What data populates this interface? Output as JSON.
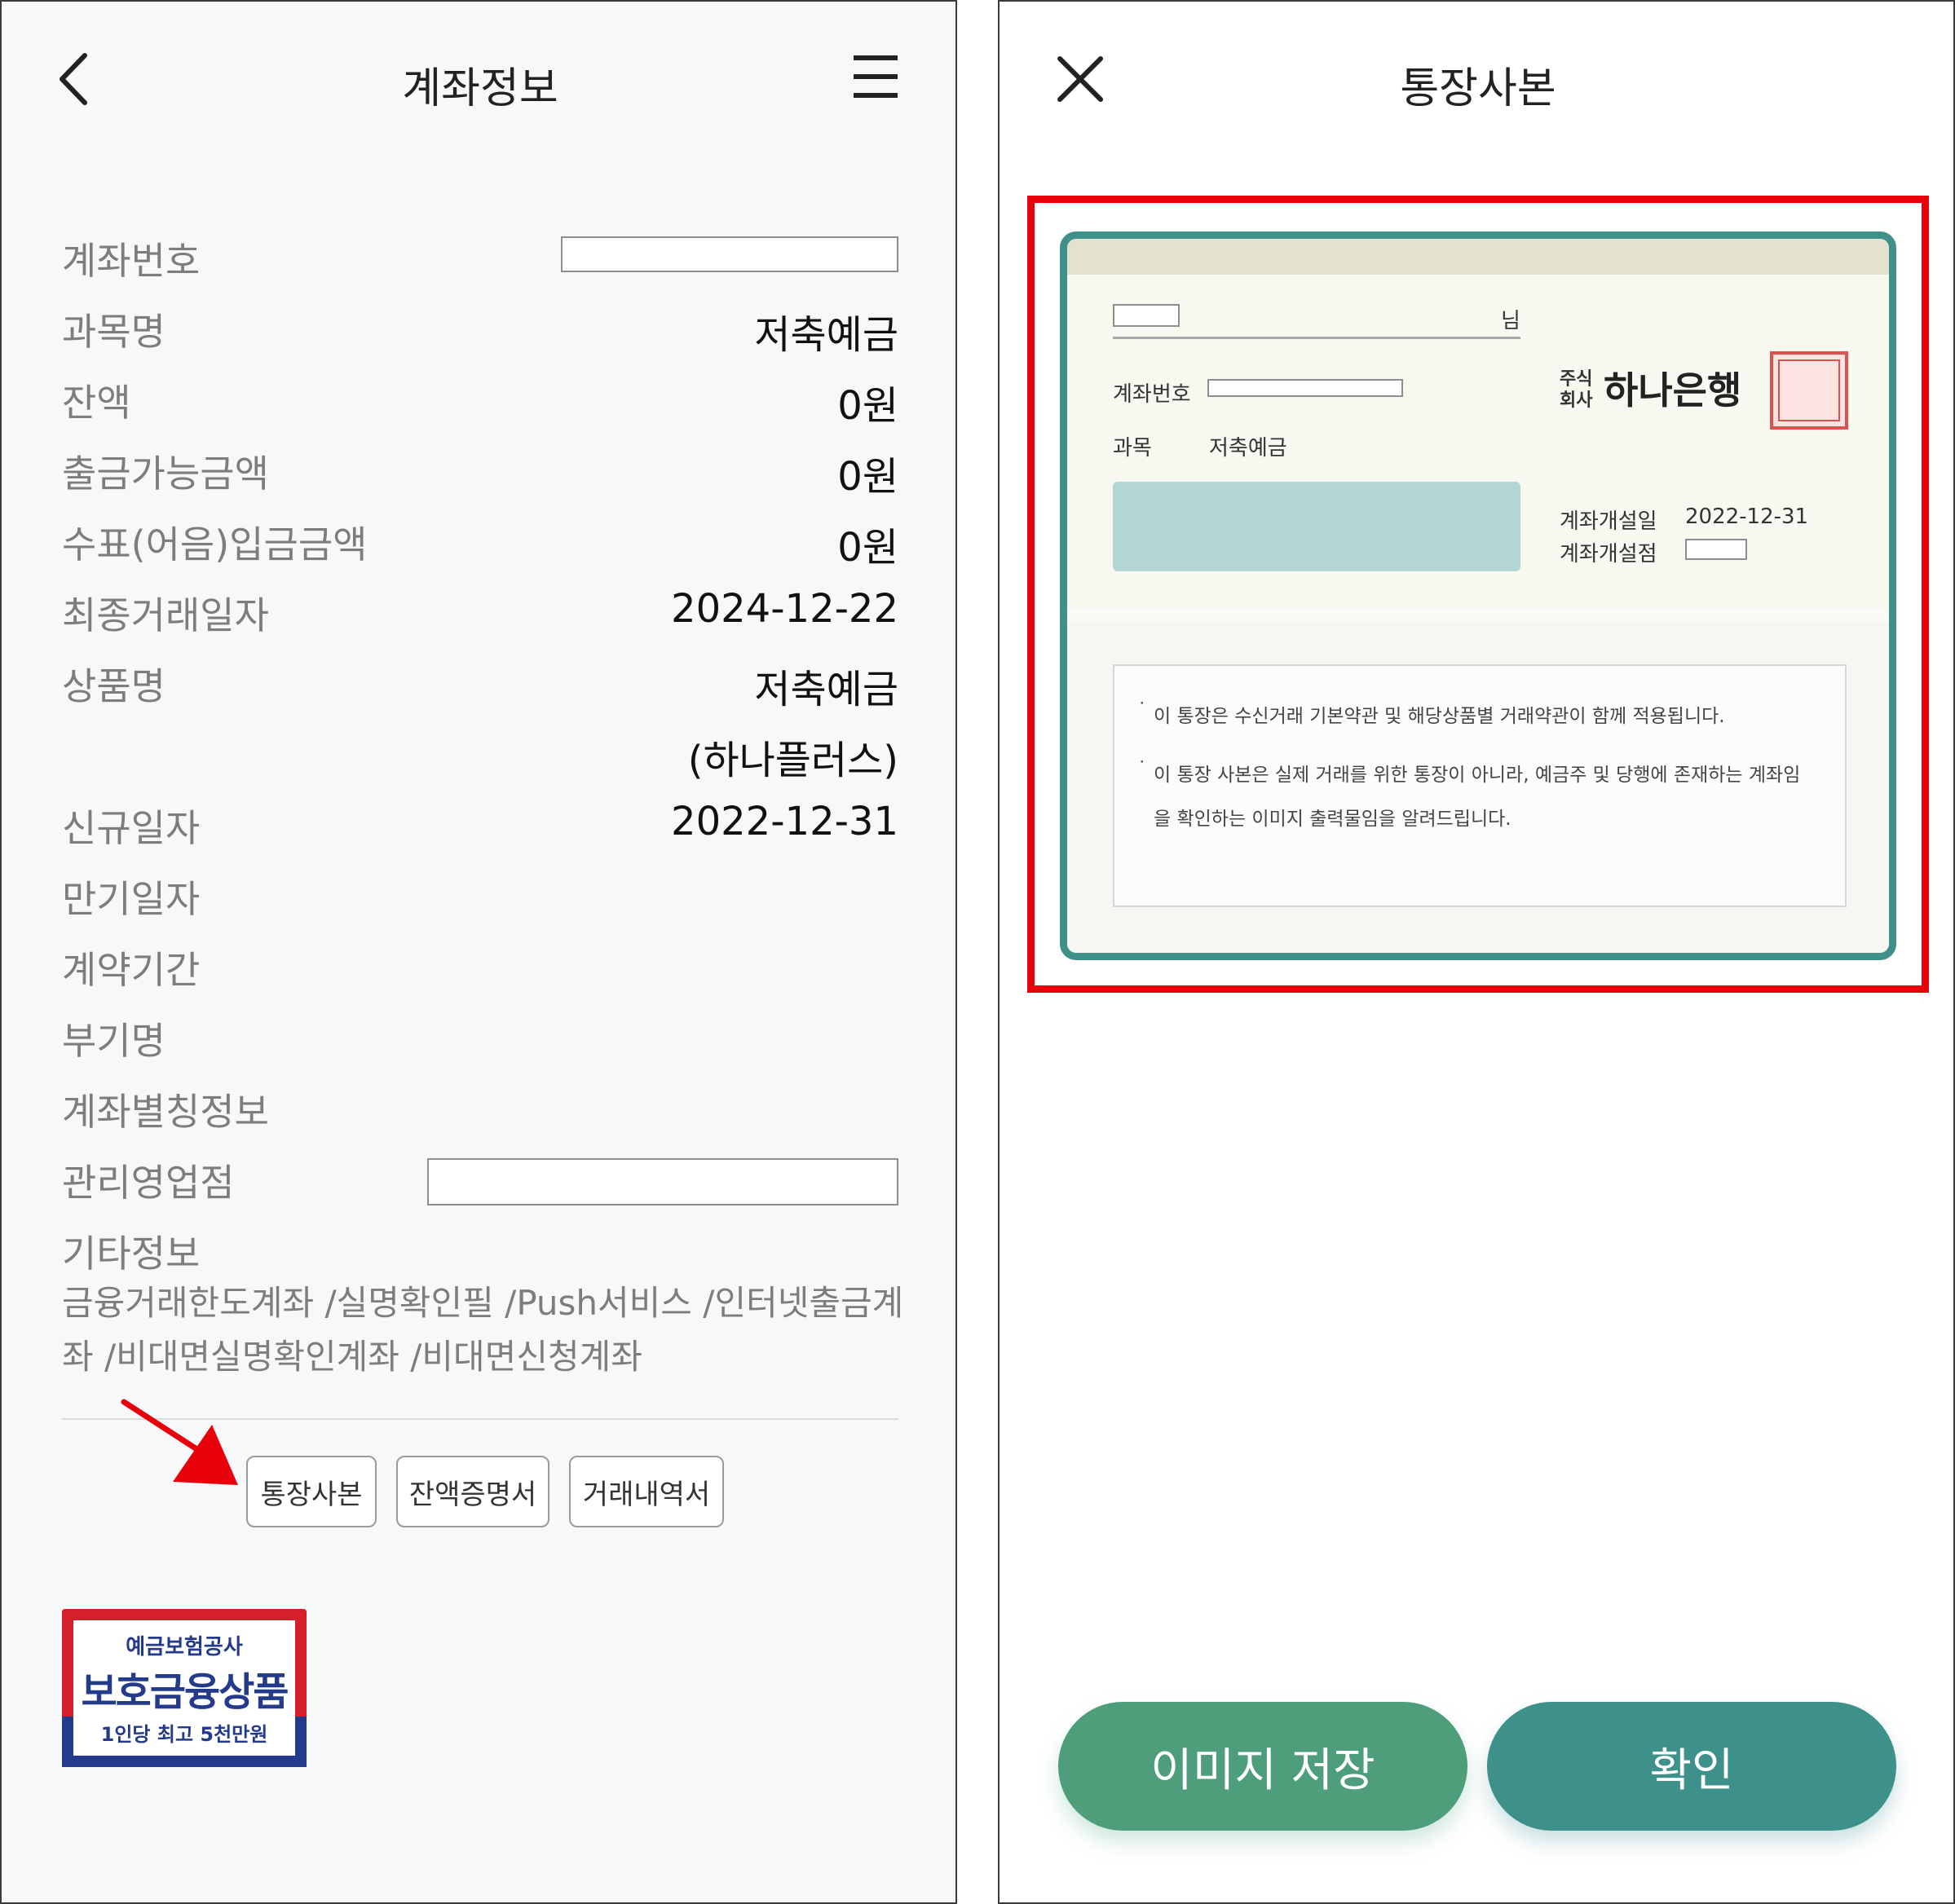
{
  "left": {
    "title": "계좌정보",
    "rows": [
      {
        "label": "계좌번호",
        "value": ""
      },
      {
        "label": "과목명",
        "value": "저축예금"
      },
      {
        "label": "잔액",
        "value": "0원"
      },
      {
        "label": "출금가능금액",
        "value": "0원"
      },
      {
        "label": "수표(어음)입금금액",
        "value": "0원"
      },
      {
        "label": "최종거래일자",
        "value": "2024-12-22"
      },
      {
        "label": "상품명",
        "value": "저축예금"
      },
      {
        "label": "",
        "value": "(하나플러스)"
      },
      {
        "label": "신규일자",
        "value": "2022-12-31"
      },
      {
        "label": "만기일자",
        "value": ""
      },
      {
        "label": "계약기간",
        "value": ""
      },
      {
        "label": "부기명",
        "value": ""
      },
      {
        "label": "계좌별칭정보",
        "value": ""
      },
      {
        "label": "관리영업점",
        "value": ""
      },
      {
        "label": "기타정보",
        "value": ""
      }
    ],
    "etc_text": "금융거래한도계좌 /실명확인필 /Push서비스 /인터넷출금계좌 /비대면실명확인계좌 /비대면신청계좌",
    "buttons": {
      "passbook": "통장사본",
      "balance": "잔액증명서",
      "history": "거래내역서"
    },
    "badge": {
      "line1": "예금보험공사",
      "line2": "보호금융상품",
      "line3": "1인당 최고 5천만원"
    }
  },
  "right": {
    "title": "통장사본",
    "passbook": {
      "suffix": "님",
      "account_label": "계좌번호",
      "subject_label": "과목",
      "subject_value": "저축예금",
      "corp_top": "주식",
      "corp_bottom": "회사",
      "bank_name": "하나은행",
      "open_date_label": "계좌개설일",
      "open_date_value": "2022-12-31",
      "open_branch_label": "계좌개설점",
      "notice1": "이 통장은 수신거래 기본약관 및 해당상품별 거래약관이 함께 적용됩니다.",
      "notice2a": "이 통장 사본은 실제 거래를 위한 통장이 아니라, 예금주 및 당행에 존재하는 계좌임",
      "notice2b": "을 확인하는 이미지 출력물임을 알려드립니다."
    },
    "save_button": "이미지 저장",
    "ok_button": "확인"
  },
  "colors": {
    "highlight": "#e8000b",
    "passbook_border": "#3e9088",
    "save": "#4f9e7b",
    "ok": "#3e908a",
    "badge_blue": "#243a8b",
    "badge_red": "#d41f2c"
  }
}
